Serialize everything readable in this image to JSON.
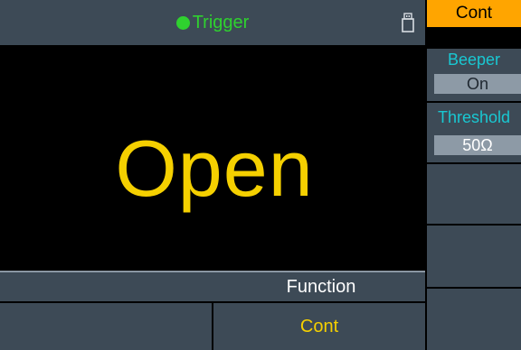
{
  "header": {
    "title": "Trigger",
    "status_color": "#2fd12f",
    "usb_icon": "usb-drive-icon"
  },
  "display": {
    "main_value": "Open",
    "value_color": "#f5d000"
  },
  "function_bar": {
    "label": "Function",
    "tabs": [
      {
        "label": ""
      },
      {
        "label": "Cont"
      }
    ]
  },
  "side_menu": {
    "header": "Cont",
    "header_color": "#ffa500",
    "items": [
      {
        "label": "Beeper",
        "value": "On"
      },
      {
        "label": "Threshold",
        "value": "50Ω"
      },
      {
        "label": "",
        "value": ""
      },
      {
        "label": "",
        "value": ""
      },
      {
        "label": "",
        "value": ""
      }
    ]
  }
}
